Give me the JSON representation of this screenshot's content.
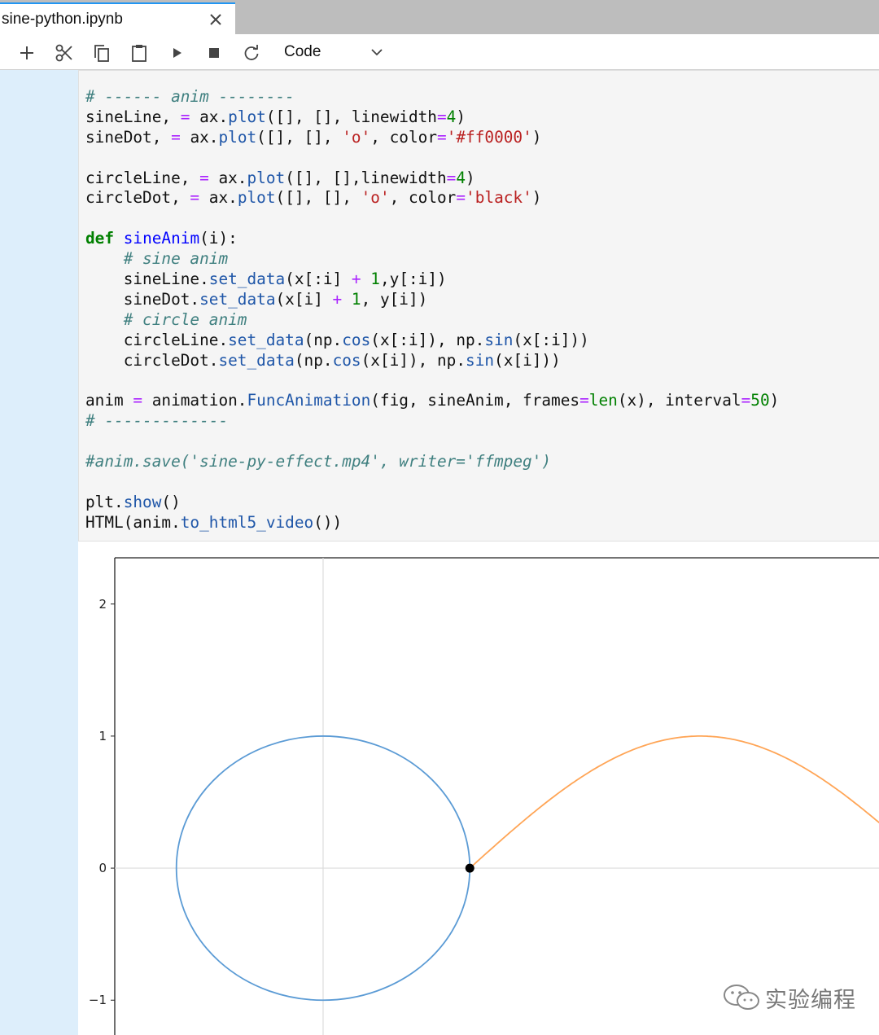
{
  "tab": {
    "title": "sine-python.ipynb",
    "close_icon": "close-icon"
  },
  "toolbar": {
    "buttons": [
      "add-cell-icon",
      "cut-icon",
      "copy-icon",
      "paste-icon",
      "run-icon",
      "stop-icon",
      "restart-icon"
    ],
    "cell_type": "Code"
  },
  "code": {
    "lines": [
      [
        [
          "c-com",
          "# ------ anim --------"
        ]
      ],
      [
        [
          "",
          "sineLine, "
        ],
        [
          "c-op",
          "="
        ],
        [
          "",
          " ax."
        ],
        [
          "c-att",
          "plot"
        ],
        [
          "",
          "([], [], linewidth"
        ],
        [
          "c-op",
          "="
        ],
        [
          "c-num",
          "4"
        ],
        [
          "",
          ")"
        ]
      ],
      [
        [
          "",
          "sineDot, "
        ],
        [
          "c-op",
          "="
        ],
        [
          "",
          " ax."
        ],
        [
          "c-att",
          "plot"
        ],
        [
          "",
          "([], [], "
        ],
        [
          "c-str",
          "'o'"
        ],
        [
          "",
          ", color"
        ],
        [
          "c-op",
          "="
        ],
        [
          "c-str",
          "'#ff0000'"
        ],
        [
          "",
          ")"
        ]
      ],
      [
        [
          "",
          ""
        ]
      ],
      [
        [
          "",
          "circleLine, "
        ],
        [
          "c-op",
          "="
        ],
        [
          "",
          " ax."
        ],
        [
          "c-att",
          "plot"
        ],
        [
          "",
          "([], [],linewidth"
        ],
        [
          "c-op",
          "="
        ],
        [
          "c-num",
          "4"
        ],
        [
          "",
          ")"
        ]
      ],
      [
        [
          "",
          "circleDot, "
        ],
        [
          "c-op",
          "="
        ],
        [
          "",
          " ax."
        ],
        [
          "c-att",
          "plot"
        ],
        [
          "",
          "([], [], "
        ],
        [
          "c-str",
          "'o'"
        ],
        [
          "",
          ", color"
        ],
        [
          "c-op",
          "="
        ],
        [
          "c-str",
          "'black'"
        ],
        [
          "",
          ")"
        ]
      ],
      [
        [
          "",
          ""
        ]
      ],
      [
        [
          "c-kw",
          "def"
        ],
        [
          "",
          " "
        ],
        [
          "c-fn",
          "sineAnim"
        ],
        [
          "",
          "(i):"
        ]
      ],
      [
        [
          "",
          "    "
        ],
        [
          "c-com",
          "# sine anim"
        ]
      ],
      [
        [
          "",
          "    sineLine."
        ],
        [
          "c-att",
          "set_data"
        ],
        [
          "",
          "(x[:i] "
        ],
        [
          "c-op",
          "+"
        ],
        [
          "",
          " "
        ],
        [
          "c-num",
          "1"
        ],
        [
          "",
          ",y[:i])"
        ]
      ],
      [
        [
          "",
          "    sineDot."
        ],
        [
          "c-att",
          "set_data"
        ],
        [
          "",
          "(x[i] "
        ],
        [
          "c-op",
          "+"
        ],
        [
          "",
          " "
        ],
        [
          "c-num",
          "1"
        ],
        [
          "",
          ", y[i])"
        ]
      ],
      [
        [
          "",
          "    "
        ],
        [
          "c-com",
          "# circle anim"
        ]
      ],
      [
        [
          "",
          "    circleLine."
        ],
        [
          "c-att",
          "set_data"
        ],
        [
          "",
          "(np."
        ],
        [
          "c-att",
          "cos"
        ],
        [
          "",
          "(x[:i]), np."
        ],
        [
          "c-att",
          "sin"
        ],
        [
          "",
          "(x[:i]))"
        ]
      ],
      [
        [
          "",
          "    circleDot."
        ],
        [
          "c-att",
          "set_data"
        ],
        [
          "",
          "(np."
        ],
        [
          "c-att",
          "cos"
        ],
        [
          "",
          "(x[i]), np."
        ],
        [
          "c-att",
          "sin"
        ],
        [
          "",
          "(x[i]))"
        ]
      ],
      [
        [
          "",
          ""
        ]
      ],
      [
        [
          "",
          "anim "
        ],
        [
          "c-op",
          "="
        ],
        [
          "",
          " animation."
        ],
        [
          "c-att",
          "FuncAnimation"
        ],
        [
          "",
          "(fig, sineAnim, frames"
        ],
        [
          "c-op",
          "="
        ],
        [
          "c-num",
          "len"
        ],
        [
          "",
          "(x), interval"
        ],
        [
          "c-op",
          "="
        ],
        [
          "c-num",
          "50"
        ],
        [
          "",
          ")"
        ]
      ],
      [
        [
          "c-com",
          "# -------------"
        ]
      ],
      [
        [
          "",
          ""
        ]
      ],
      [
        [
          "c-com",
          "#anim.save('sine-py-effect.mp4', writer='ffmpeg')"
        ]
      ],
      [
        [
          "",
          ""
        ]
      ],
      [
        [
          "",
          "plt."
        ],
        [
          "c-att",
          "show"
        ],
        [
          "",
          "()"
        ]
      ],
      [
        [
          "",
          "HTML(anim."
        ],
        [
          "c-att",
          "to_html5_video"
        ],
        [
          "",
          "())"
        ]
      ]
    ]
  },
  "chart_data": {
    "type": "line",
    "yticks": [
      2,
      1,
      0,
      -1
    ],
    "ytick_labels": [
      "2",
      "1",
      "0",
      "−1"
    ],
    "xlim": [
      -1.42,
      3.85
    ],
    "ylim": [
      -1.35,
      2.35
    ],
    "grid": true,
    "series": [
      {
        "kind": "circle",
        "center": [
          0,
          0
        ],
        "radius": 1,
        "color": "#5b9bd5"
      },
      {
        "kind": "sine",
        "x_start": 1,
        "x_end": 3.85,
        "x_offset": 1,
        "color": "#ffa556"
      },
      {
        "kind": "point",
        "x": 1,
        "y": 0,
        "color": "#000000"
      }
    ]
  },
  "watermark": {
    "text": "实验编程",
    "icon": "wechat-icon"
  }
}
